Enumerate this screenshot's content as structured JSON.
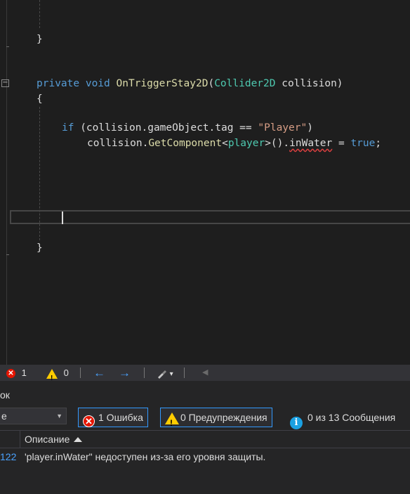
{
  "editor": {
    "code": {
      "brace_close_1": "}",
      "private_kw": "private",
      "void_kw": "void",
      "method_name": "OnTriggerStay2D",
      "paren_open": "(",
      "param_type": "Collider2D",
      "param_rest": " collision)",
      "brace_open": "{",
      "if_kw": "if",
      "if_cond": " (collision.gameObject.tag == ",
      "if_str": "\"Player\"",
      "if_close": ")",
      "stmt_a": "collision.",
      "stmt_method": "GetComponent",
      "stmt_lt": "<",
      "stmt_type": "player",
      "stmt_gt": ">().",
      "stmt_error_member": "inWater",
      "stmt_eq": " = ",
      "stmt_true": "true",
      "stmt_semicolon": ";",
      "brace_close_2": "}"
    },
    "collapse_glyph": "−"
  },
  "statusbar": {
    "error_count": "1",
    "warning_count": "0",
    "back_arrow": "←",
    "forward_arrow": "→",
    "brush_dropdown": "▾"
  },
  "error_list": {
    "title_fragment": "ок",
    "scope_value": "е",
    "errors_filter": "1 Ошибка",
    "warnings_filter": "0 Предупреждения",
    "messages_filter": "0 из 13 Сообщения",
    "column_description": "Описание",
    "rows": [
      {
        "line_fragment": "122",
        "description": "'player.inWater\" недоступен из-за его уровня защиты."
      }
    ]
  },
  "colors": {
    "editor_bg": "#1e1e1e",
    "keyword": "#569cd6",
    "type": "#4ec9b0",
    "method": "#dcdcaa",
    "string": "#d69d85",
    "accent": "#3399ff",
    "error": "#e51400",
    "warning": "#ffcc00",
    "info": "#1ba1e2"
  }
}
